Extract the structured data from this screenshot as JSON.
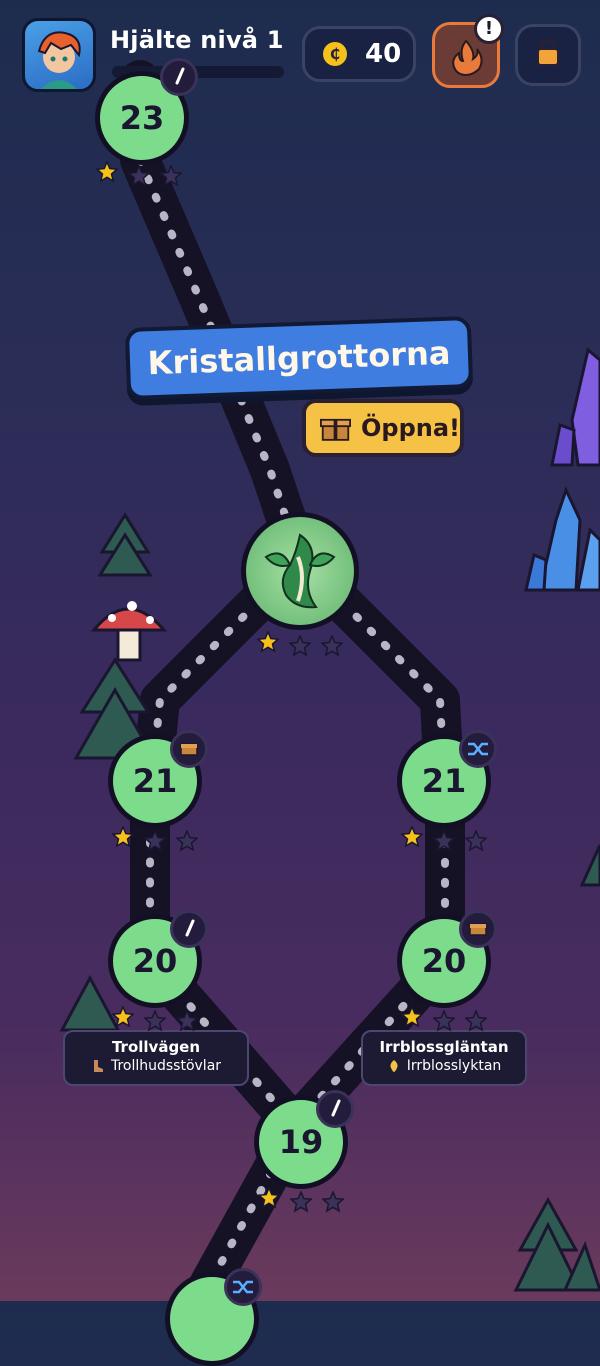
{
  "hud": {
    "hero_title": "Hjälte nivå 1",
    "xp_progress": 0,
    "coin_symbol": "₵",
    "coins": "40",
    "alert_mark": "!",
    "fire_icon": "fire-icon",
    "bag_icon": "bag-icon"
  },
  "chapter": {
    "title": "Kristallgrottorna",
    "open_label": "Öppna!"
  },
  "levels": {
    "top": {
      "number": "23",
      "stars": 1,
      "badge": "sword-icon"
    },
    "boss": {
      "stars": 1
    },
    "left_21": {
      "number": "21",
      "stars": 1,
      "badge": "chest-icon"
    },
    "right_21": {
      "number": "21",
      "stars": 1,
      "badge": "shuffle-icon"
    },
    "left_20": {
      "number": "20",
      "stars": 1,
      "badge": "sword-icon"
    },
    "right_20": {
      "number": "20",
      "stars": 1,
      "badge": "chest-icon"
    },
    "bottom_19": {
      "number": "19",
      "stars": 1,
      "badge": "sword-icon"
    },
    "bottom_partial": {
      "badge": "shuffle-icon"
    }
  },
  "routes": {
    "left": {
      "title": "Trollvägen",
      "reward": "Trollhudsstövlar",
      "icon": "boot-icon"
    },
    "right": {
      "title": "Irrblossgläntan",
      "reward": "Irrblosslyktan",
      "icon": "lantern-icon"
    }
  },
  "colors": {
    "node_green": "#7ddb8c",
    "star_gold": "#f6c21a",
    "banner_blue": "#3f7de0",
    "open_yellow": "#f6c245",
    "fire_border": "#e87a3c"
  }
}
